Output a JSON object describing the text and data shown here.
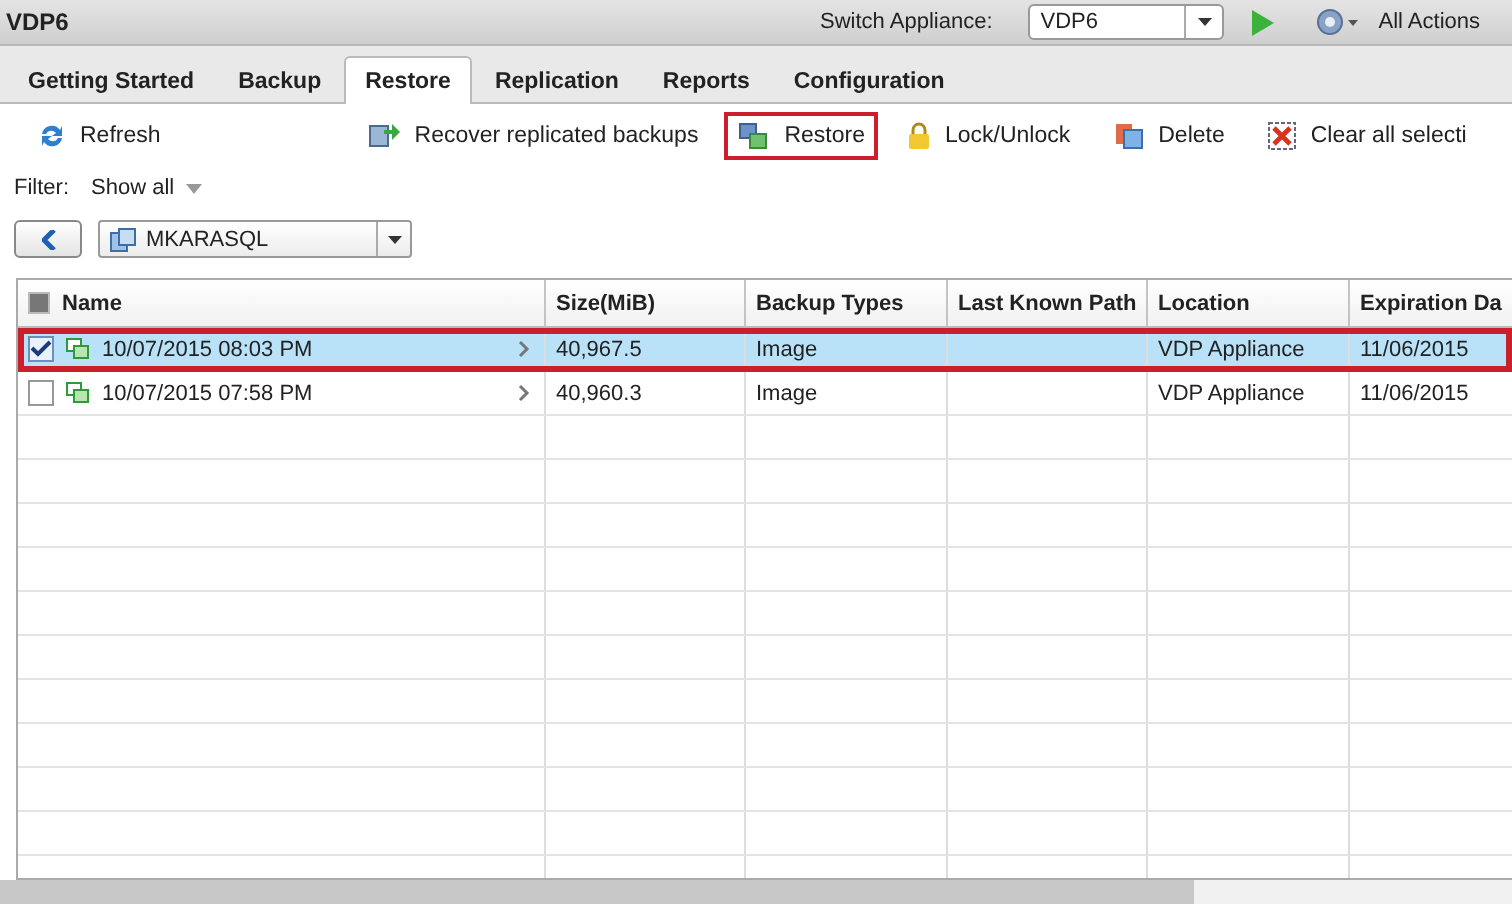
{
  "header": {
    "title": "VDP6",
    "switch_label": "Switch Appliance:",
    "appliance": "VDP6",
    "actions": "All Actions"
  },
  "tabs": [
    {
      "label": "Getting Started",
      "selected": false
    },
    {
      "label": "Backup",
      "selected": false
    },
    {
      "label": "Restore",
      "selected": true
    },
    {
      "label": "Replication",
      "selected": false
    },
    {
      "label": "Reports",
      "selected": false
    },
    {
      "label": "Configuration",
      "selected": false
    }
  ],
  "toolbar": [
    {
      "label": "Refresh",
      "highlighted": false
    },
    {
      "label": "Recover replicated backups",
      "highlighted": false
    },
    {
      "label": "Restore",
      "highlighted": true
    },
    {
      "label": "Lock/Unlock",
      "highlighted": false
    },
    {
      "label": "Delete",
      "highlighted": false
    },
    {
      "label": "Clear all selecti",
      "highlighted": false
    }
  ],
  "filter": {
    "label": "Filter:",
    "value": "Show all"
  },
  "client": {
    "value": "MKARASQL"
  },
  "table": {
    "select_all": {
      "indeterminate": true
    },
    "columns": [
      "Name",
      "Size(MiB)",
      "Backup Types",
      "Last Known Path",
      "Location",
      "Expiration Da"
    ],
    "rows": [
      {
        "selected": true,
        "checked": true,
        "highlighted": true,
        "cells": [
          "10/07/2015 08:03 PM",
          "40,967.5",
          "Image",
          "",
          "VDP Appliance",
          "11/06/2015"
        ]
      },
      {
        "selected": false,
        "checked": false,
        "highlighted": false,
        "cells": [
          "10/07/2015 07:58 PM",
          "40,960.3",
          "Image",
          "",
          "VDP Appliance",
          "11/06/2015"
        ]
      }
    ]
  }
}
